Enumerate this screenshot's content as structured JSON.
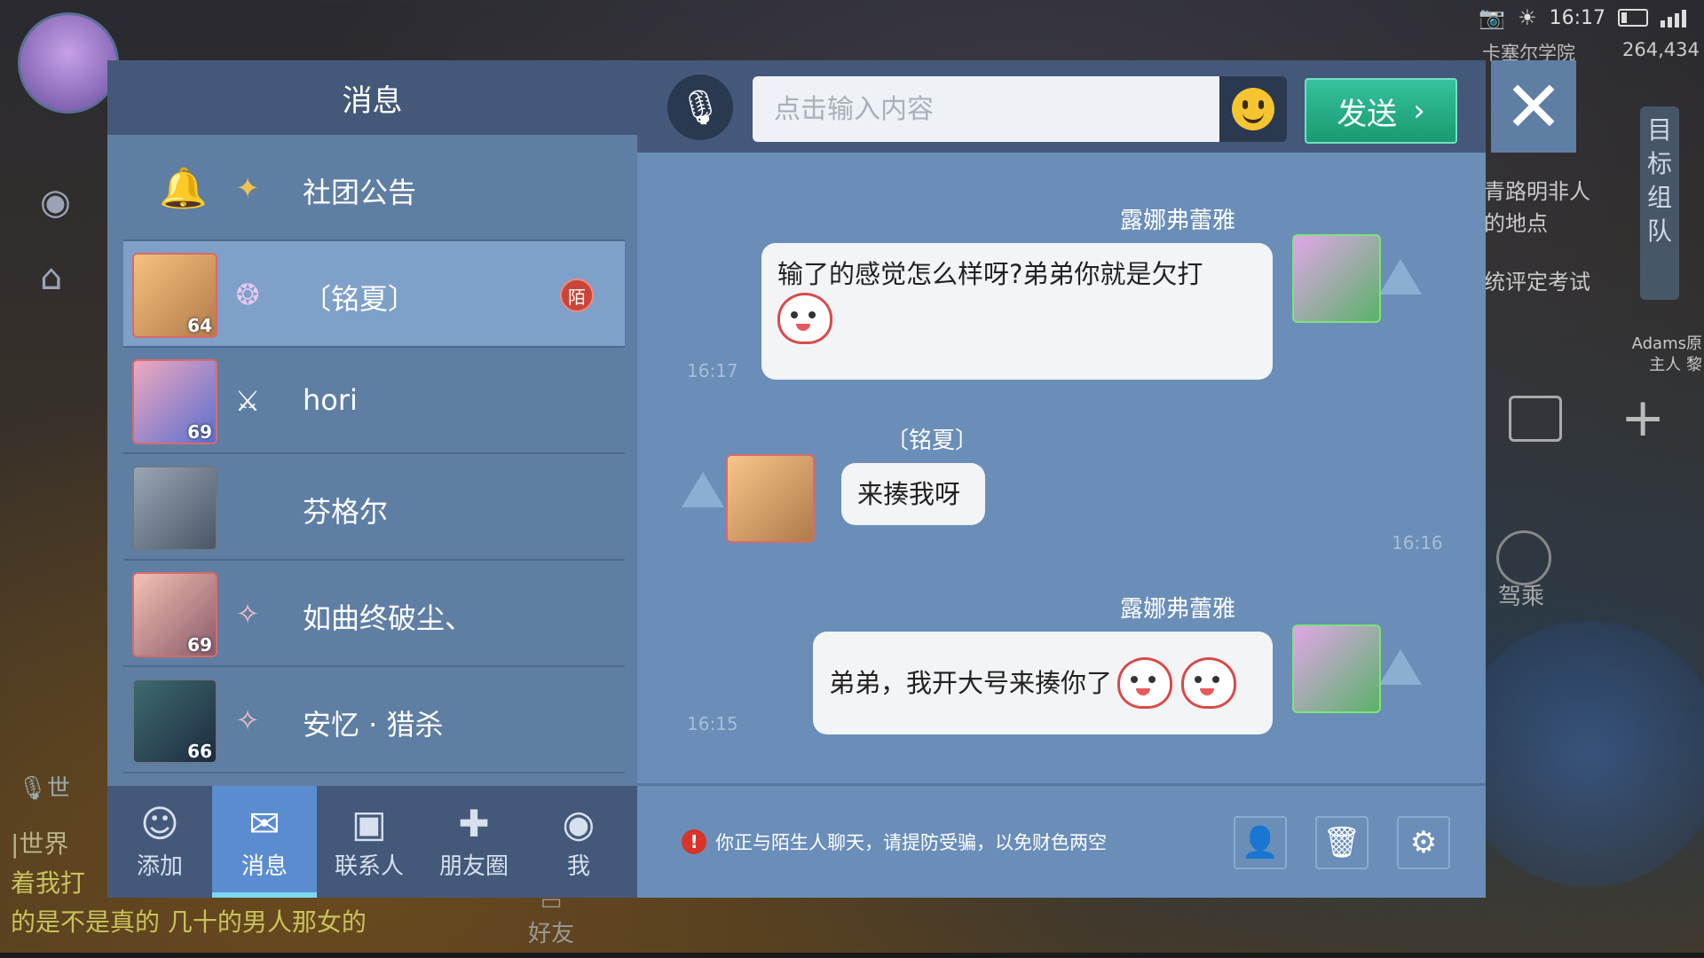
{
  "status_bar": {
    "time": "16:17",
    "server_name": "卡塞尔学院",
    "server_number": "264,434"
  },
  "background": {
    "world_chat": [
      {
        "tag": "|世界",
        "text": ""
      },
      {
        "tag": "",
        "text": "着我打"
      },
      {
        "tag": "",
        "text": "的是不是真的  几十的男人那女的"
      }
    ],
    "right_texts": [
      "青路明非人",
      "的地点",
      "统评定考试"
    ],
    "target_panel": "目标组队",
    "adams": "Adams原 主人 黎",
    "steer_label": "驾乘",
    "friends_label": "好友"
  },
  "left_panel": {
    "title": "消息",
    "notice": {
      "label": "社团公告"
    },
    "conversations": [
      {
        "name": "〔铭夏〕",
        "level": "64",
        "badge": "陌",
        "active": true
      },
      {
        "name": "hori",
        "level": "69",
        "badge": "",
        "active": false
      },
      {
        "name": "芬格尔",
        "level": "",
        "badge": "",
        "active": false
      },
      {
        "name": "如曲终破尘、",
        "level": "69",
        "badge": "",
        "active": false
      },
      {
        "name": "安忆 · 猎杀",
        "level": "66",
        "badge": "",
        "active": false
      }
    ],
    "tabs": [
      {
        "label": "添加",
        "icon": "add-friend-icon",
        "active": false
      },
      {
        "label": "消息",
        "icon": "message-icon",
        "active": true
      },
      {
        "label": "联系人",
        "icon": "contacts-icon",
        "active": false
      },
      {
        "label": "朋友圈",
        "icon": "moments-icon",
        "active": false
      },
      {
        "label": "我",
        "icon": "profile-icon",
        "active": false
      }
    ]
  },
  "chat": {
    "input_placeholder": "点击输入内容",
    "send_label": "发送",
    "messages": [
      {
        "sender": "露娜弗蕾雅",
        "text": "输了的感觉怎么样呀?弟弟你就是欠打",
        "time": "16:17",
        "side": "right"
      },
      {
        "sender": "〔铭夏〕",
        "text": "来揍我呀",
        "time": "16:16",
        "side": "left"
      },
      {
        "sender": "露娜弗蕾雅",
        "text": "弟弟，我开大号来揍你了",
        "time": "16:15",
        "side": "right"
      }
    ],
    "warning": "你正与陌生人聊天，请提防受骗，以免财色两空"
  },
  "colors": {
    "panel": "#5f7ea3",
    "header": "#44597a",
    "send": "#1a9a72",
    "active_tab": "#5b8ccf"
  }
}
